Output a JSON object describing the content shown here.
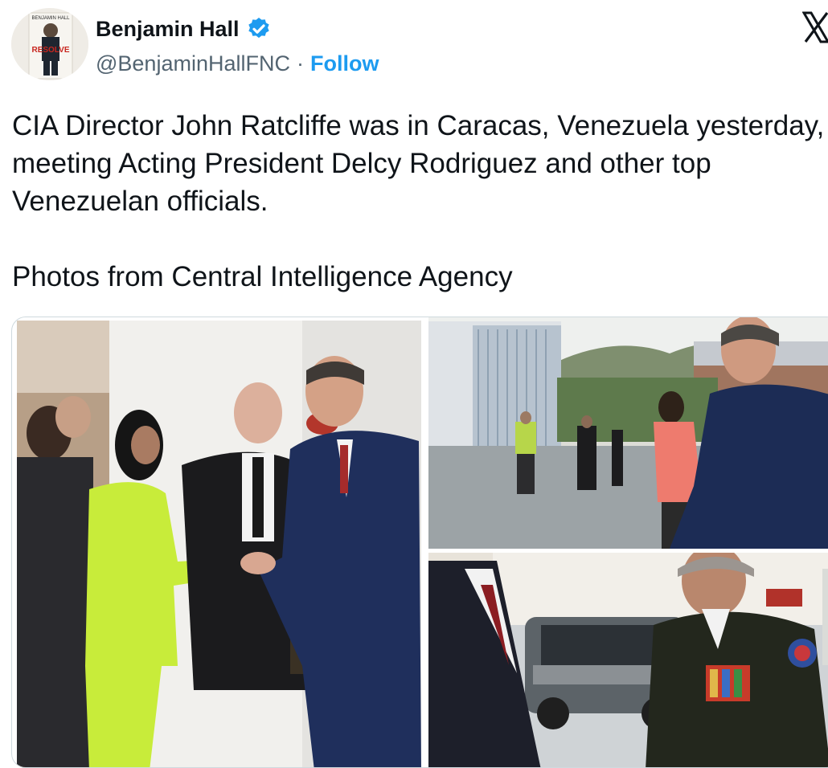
{
  "tweet": {
    "author_name": "Benjamin Hall",
    "handle": "@BenjaminHallFNC",
    "separator": "·",
    "follow_label": "Follow",
    "paragraphs": [
      "CIA Director John Ratcliffe was in Caracas, Venezuela yesterday, meeting Acting President Delcy Rodriguez and other top Venezuelan officials.",
      "Photos from Central Intelligence Agency"
    ],
    "avatar_book": {
      "top_text": "BENJAMIN HALL",
      "title": "RESOLVE"
    }
  },
  "icons": {
    "verified": "verified-badge-icon",
    "platform": "x-logo-icon"
  },
  "colors": {
    "link": "#1d9bf0",
    "secondary_text": "#536471",
    "primary_text": "#0f1419",
    "border": "#cfd9de"
  },
  "media": {
    "photos": [
      {
        "description_icon": "photo-handshake"
      },
      {
        "description_icon": "photo-airport-arrival"
      },
      {
        "description_icon": "photo-military-officer"
      }
    ]
  }
}
